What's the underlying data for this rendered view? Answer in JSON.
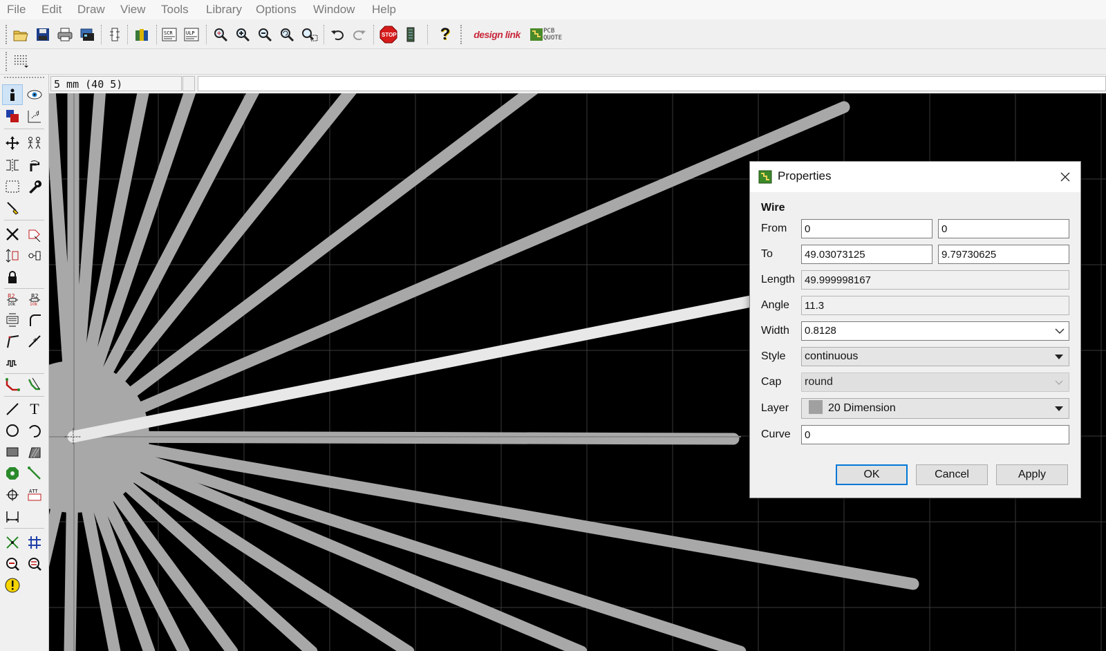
{
  "menu": [
    "File",
    "Edit",
    "Draw",
    "View",
    "Tools",
    "Library",
    "Options",
    "Window",
    "Help"
  ],
  "toolbar": {
    "icons": [
      "open-icon",
      "save-icon",
      "print-icon",
      "cam-icon",
      "board-switch-icon",
      "library-icon",
      "script-icon",
      "ulp-icon",
      "zoom-fit-icon",
      "zoom-in-icon",
      "zoom-out-icon",
      "zoom-redraw-icon",
      "zoom-area-icon",
      "undo-icon",
      "redo-icon",
      "stop-icon",
      "drc-icon",
      "help-icon"
    ],
    "designlink_label": "design link",
    "pcbquote_label": "PCB QUOTE",
    "stop_label": "STOP",
    "help_label": "?"
  },
  "coord_display": "5 mm (40 5)",
  "command_line": "",
  "dialog": {
    "title": "Properties",
    "section": "Wire",
    "labels": {
      "from": "From",
      "to": "To",
      "length": "Length",
      "angle": "Angle",
      "width": "Width",
      "style": "Style",
      "cap": "Cap",
      "layer": "Layer",
      "curve": "Curve"
    },
    "from_x": "0",
    "from_y": "0",
    "to_x": "49.03073125",
    "to_y": "9.79730625",
    "length": "49.999998167",
    "angle": "11.3",
    "width": "0.8128",
    "style": "continuous",
    "cap": "round",
    "layer": "20 Dimension",
    "layer_color": "#a0a0a0",
    "curve": "0",
    "buttons": {
      "ok": "OK",
      "cancel": "Cancel",
      "apply": "Apply"
    }
  },
  "palette": {
    "text_tool_label": "T",
    "attribute_label": "ATT"
  },
  "colors": {
    "canvas_bg": "#000000",
    "wire": "#a8a8a8",
    "wire_selected": "#e8e8e8",
    "grid": "#3a3a3a",
    "accent": "#0078d7"
  }
}
